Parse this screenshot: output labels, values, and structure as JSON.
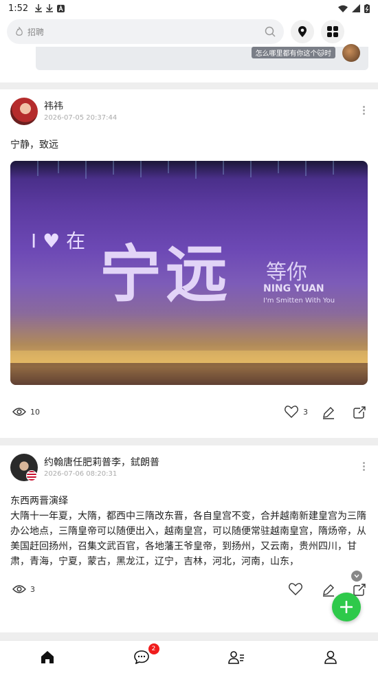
{
  "status_bar": {
    "time": "1:52"
  },
  "search": {
    "placeholder": "招聘"
  },
  "comment_preview": {
    "text": "怎么哪里都有你这个🐱时"
  },
  "posts": [
    {
      "author": "祎祎",
      "datetime": "2026-07-05 20:37:44",
      "text": "宁静，致远",
      "image_text": {
        "line1": "I ♥ 在",
        "main": "宁远",
        "side1": "等你",
        "side2": "NING YUAN",
        "side3": "I'm Smitten With You"
      },
      "views": "10",
      "likes": "3"
    },
    {
      "author": "约翰唐任肥莉普李，鉽朗普",
      "datetime": "2026-07-06 08:20:31",
      "title": "东西两晋演绎",
      "text": "大隋十一年夏，大隋，都西中三隋改东晋，各自皇宫不变，合并越南新建皇宫为三隋办公地点，三隋皇帝可以随便出入，越南皇宫，可以随便常驻越南皇宫，隋炀帝，从美国赶回扬州，召集文武百官，各地藩王爷皇帝，到扬州，又云南，贵州四川，甘肃，青海，宁夏，蒙古，黑龙江，辽宁，吉林，河北，河南，山东，",
      "views": "3",
      "likes": ""
    }
  ],
  "nav": {
    "message_badge": "2"
  },
  "colors": {
    "accent_green": "#2ec94a",
    "badge_red": "#f01c1c"
  }
}
